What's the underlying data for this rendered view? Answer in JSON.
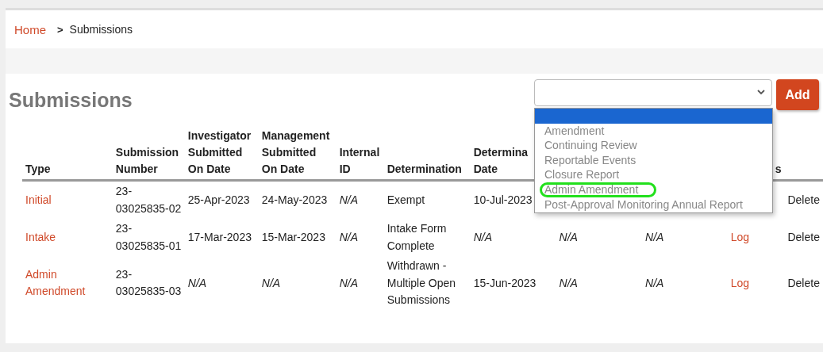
{
  "breadcrumb": {
    "items": [
      {
        "label": "Home",
        "kind": "link"
      },
      {
        "label": "Submissions",
        "kind": "current"
      }
    ],
    "separator": ">"
  },
  "page_title": "Submissions",
  "type_select": {
    "options": [
      {
        "selected": true,
        "highlighted": false
      },
      {
        "label": "Amendment",
        "selected": false,
        "highlighted": false
      },
      {
        "label": "Continuing Review",
        "selected": false,
        "highlighted": false
      },
      {
        "label": "Reportable Events",
        "selected": false,
        "highlighted": false
      },
      {
        "label": "Closure Report",
        "selected": false,
        "highlighted": false
      },
      {
        "label": "Admin Amendment",
        "selected": false,
        "highlighted": true
      },
      {
        "label": "Post-Approval Monitoring Annual Report",
        "selected": false,
        "highlighted": false
      }
    ]
  },
  "add_button": "Add",
  "table": {
    "columns": [
      {
        "lines": [
          "Type"
        ]
      },
      {
        "lines": [
          "Submission",
          "Number"
        ]
      },
      {
        "lines": [
          "Investigator",
          "Submitted",
          "On Date"
        ]
      },
      {
        "lines": [
          "Management",
          "Submitted",
          "On Date"
        ]
      },
      {
        "lines": [
          "Internal",
          "ID"
        ]
      },
      {
        "lines": [
          "Determination"
        ]
      },
      {
        "lines": [
          "Determina",
          "Date"
        ]
      },
      {},
      {},
      {
        "lines": [
          "s"
        ]
      },
      {}
    ],
    "rows": [
      {
        "cells": [
          {
            "kind": "link",
            "lines": [
              "Initial"
            ]
          },
          {
            "kind": "plain",
            "lines": [
              "23-",
              "03025835-02"
            ]
          },
          {
            "kind": "plain",
            "lines": [
              "25-Apr-2023"
            ]
          },
          {
            "kind": "plain",
            "lines": [
              "24-May-2023"
            ]
          },
          {
            "kind": "na",
            "lines": [
              "N/A"
            ]
          },
          {
            "kind": "plain",
            "lines": [
              "Exempt"
            ]
          },
          {
            "kind": "plain",
            "lines": [
              "10-Jul-2023"
            ]
          },
          {
            "kind": "hidden"
          },
          {
            "kind": "hidden"
          },
          {
            "kind": "hidden"
          },
          {
            "kind": "action",
            "lines": [
              "Delete"
            ]
          }
        ]
      },
      {
        "cells": [
          {
            "kind": "link",
            "lines": [
              "Intake"
            ]
          },
          {
            "kind": "plain",
            "lines": [
              "23-",
              "03025835-01"
            ]
          },
          {
            "kind": "plain",
            "lines": [
              "17-Mar-2023"
            ]
          },
          {
            "kind": "plain",
            "lines": [
              "15-Mar-2023"
            ]
          },
          {
            "kind": "na",
            "lines": [
              "N/A"
            ]
          },
          {
            "kind": "plain",
            "lines": [
              "Intake Form",
              "Complete"
            ]
          },
          {
            "kind": "na",
            "lines": [
              "N/A"
            ]
          },
          {
            "kind": "na",
            "lines": [
              "N/A"
            ]
          },
          {
            "kind": "na",
            "lines": [
              "N/A"
            ]
          },
          {
            "kind": "link",
            "lines": [
              "Log"
            ]
          },
          {
            "kind": "action",
            "lines": [
              "Delete"
            ]
          }
        ]
      },
      {
        "cells": [
          {
            "kind": "link",
            "lines": [
              "Admin",
              "Amendment"
            ]
          },
          {
            "kind": "plain",
            "lines": [
              "23-",
              "03025835-03"
            ]
          },
          {
            "kind": "na",
            "lines": [
              "N/A"
            ]
          },
          {
            "kind": "na",
            "lines": [
              "N/A"
            ]
          },
          {
            "kind": "na",
            "lines": [
              "N/A"
            ]
          },
          {
            "kind": "plain",
            "lines": [
              "Withdrawn -",
              "Multiple Open",
              "Submissions"
            ]
          },
          {
            "kind": "plain",
            "lines": [
              "15-Jun-2023"
            ]
          },
          {
            "kind": "na",
            "lines": [
              "N/A"
            ]
          },
          {
            "kind": "na",
            "lines": [
              "N/A"
            ]
          },
          {
            "kind": "link",
            "lines": [
              "Log"
            ]
          },
          {
            "kind": "action",
            "lines": [
              "Delete"
            ]
          }
        ]
      }
    ]
  }
}
